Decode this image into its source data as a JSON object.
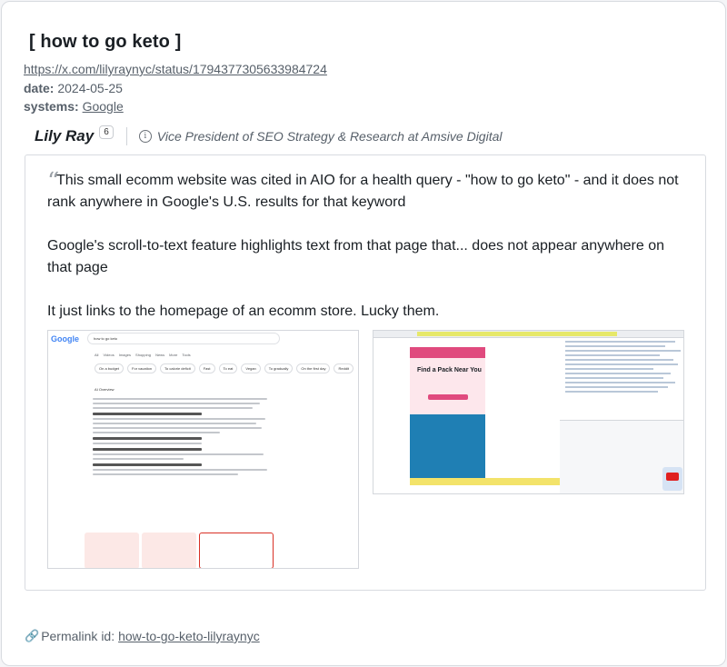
{
  "header": {
    "title": "[ how to go keto ]",
    "url": "https://x.com/lilyraynyc/status/1794377305633984724",
    "date_label": "date:",
    "date_value": "2024-05-25",
    "systems_label": "systems:",
    "systems_value": "Google"
  },
  "author": {
    "name": "Lily Ray",
    "count": "6",
    "role": "Vice President of SEO Strategy & Research at Amsive Digital"
  },
  "post": {
    "quote_mark": "“",
    "paragraphs": [
      "This small ecomm website was cited in AIO for a health query - \"how to go keto\" - and it does not rank anywhere in Google's U.S. results for that keyword",
      "Google's scroll-to-text feature highlights text from that page that... does not appear anywhere on that page",
      "It just links to the homepage of an ecomm store. Lucky them."
    ]
  },
  "screenshot_google": {
    "logo": "Google",
    "query": "how to go keto",
    "tabs": "All Videos Images Shopping News More Tools",
    "chips": [
      "On a budget",
      "For vacation",
      "To calorie deficit",
      "Fast",
      "To eat",
      "Vegan",
      "To gradually",
      "On the first day",
      "Reddit"
    ],
    "aio_label": "AI Overview"
  },
  "screenshot_dev": {
    "panel_title": "Find a Pack Near You"
  },
  "footer": {
    "permalink_label": "Permalink id:",
    "permalink_id": "how-to-go-keto-lilyraynyc"
  }
}
